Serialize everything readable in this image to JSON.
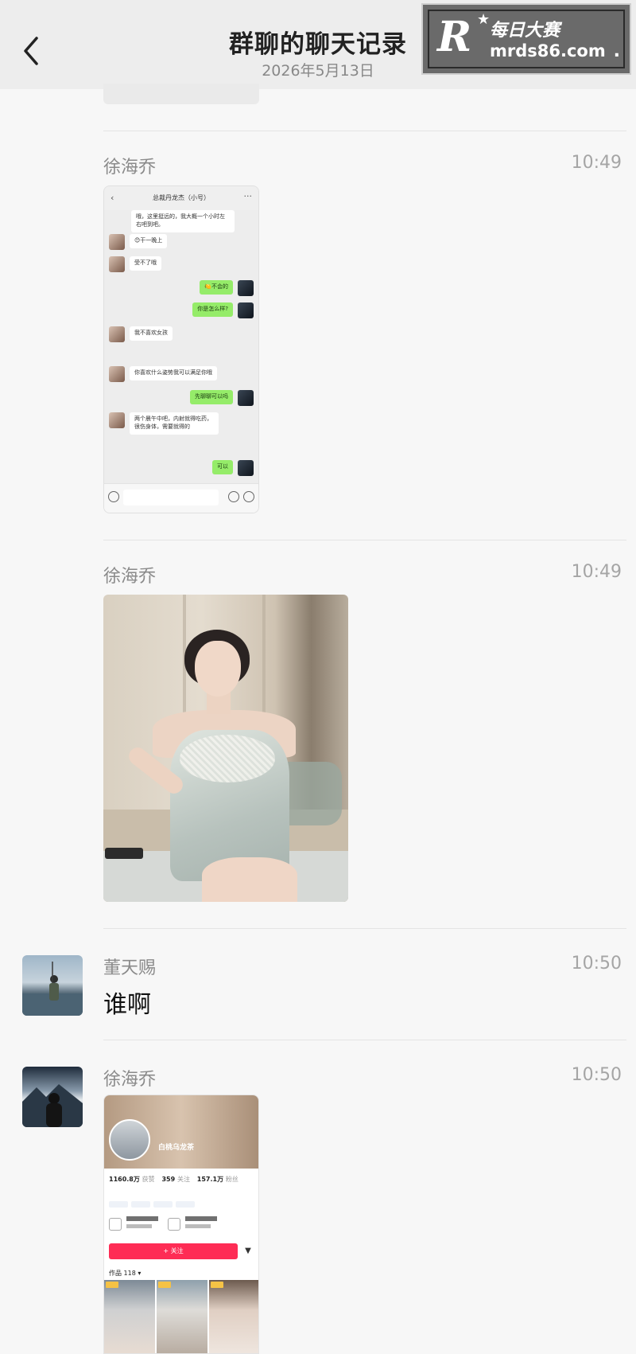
{
  "header": {
    "title": "群聊的聊天记录",
    "date": "2026年5月13日",
    "back_icon": "chevron-left-icon"
  },
  "watermark": {
    "logo_letter": "R",
    "brand_cn": "每日大赛",
    "url": "mrds86.com",
    "suffix": "."
  },
  "messages": [
    {
      "sender": "徐海乔",
      "time": "10:49",
      "type": "image",
      "image_desc_name": "chat-screenshot",
      "embedded_chat": {
        "title": "总裁丹龙杰（小号）",
        "lines": [
          {
            "side": "left",
            "text": "哦，这里挺远的，我大概一个小时左右吧到吧。"
          },
          {
            "side": "left",
            "text": "😊干一晚上"
          },
          {
            "side": "left",
            "text": "受不了哦"
          },
          {
            "side": "right",
            "text": "🍋不会的"
          },
          {
            "side": "right",
            "text": "你是怎么样?"
          },
          {
            "side": "left",
            "text": "我不喜欢女孩"
          },
          {
            "side": "left",
            "text": "你喜欢什么姿势我可以满足你哦"
          },
          {
            "side": "right",
            "text": "先聊聊可以吗"
          },
          {
            "side": "left",
            "text": "两个晨午中吧，内射就得吃药，很伤身体，需要就得的"
          },
          {
            "side": "right",
            "text": "可以"
          }
        ]
      }
    },
    {
      "sender": "徐海乔",
      "time": "10:49",
      "type": "image",
      "image_desc_name": "photo"
    },
    {
      "sender": "董天赐",
      "time": "10:50",
      "type": "text",
      "text": "谁啊"
    },
    {
      "sender": "徐海乔",
      "time": "10:50",
      "type": "image",
      "image_desc_name": "profile-screenshot",
      "profile": {
        "name": "白桃乌龙茶",
        "stats": [
          {
            "value": "1160.8万",
            "label": "获赞"
          },
          {
            "value": "359",
            "label": "关注"
          },
          {
            "value": "157.1万",
            "label": "粉丝"
          }
        ],
        "follow_label": "+ 关注",
        "works_label": "作品 118 ▾"
      }
    }
  ]
}
